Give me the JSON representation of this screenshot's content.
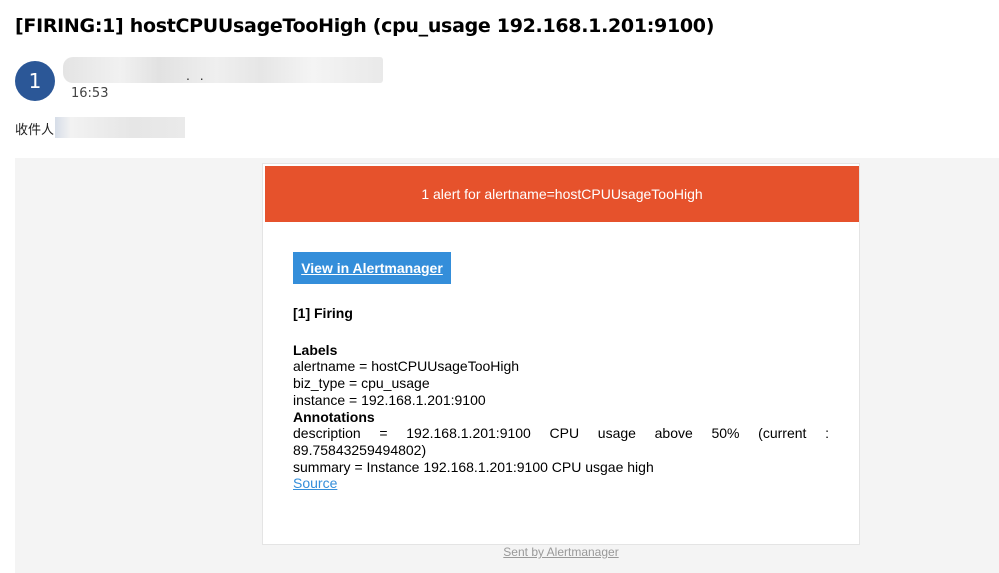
{
  "email": {
    "subject": "[FIRING:1] hostCPUUsageTooHigh (cpu_usage 192.168.1.201:9100)",
    "avatar_text": "1",
    "sender_dots": ". .",
    "time": "16:53",
    "recipient_label": "收件人"
  },
  "alert": {
    "banner": "1 alert for alertname=hostCPUUsageTooHigh",
    "button_label": "View in Alertmanager",
    "firing_title": "[1] Firing",
    "labels_heading": "Labels",
    "labels": [
      "alertname = hostCPUUsageTooHigh",
      "biz_type = cpu_usage",
      "instance = 192.168.1.201:9100"
    ],
    "annotations_heading": "Annotations",
    "annotations": [
      "description = 192.168.1.201:9100 CPU usage above 50% (current : 89.75843259494802)",
      "summary = Instance 192.168.1.201:9100 CPU usgae high"
    ],
    "source_link": "Source",
    "footer": "Sent by Alertmanager"
  },
  "colors": {
    "banner_bg": "#e6522c",
    "button_bg": "#348eda",
    "avatar_bg": "#2b5797",
    "mail_bg": "#f4f4f4"
  }
}
